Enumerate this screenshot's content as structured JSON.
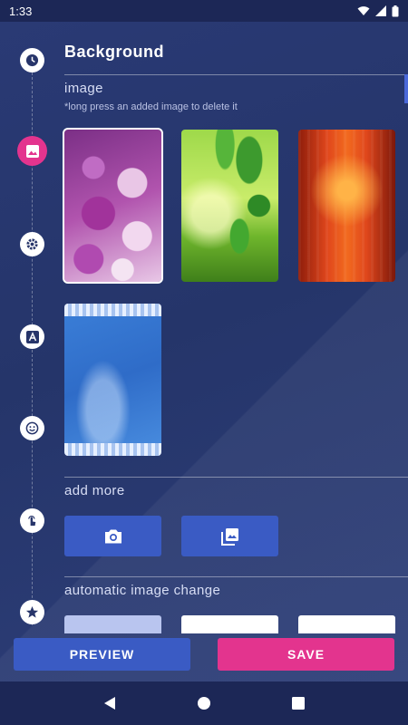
{
  "status_bar": {
    "time": "1:33"
  },
  "header": {
    "title": "Background"
  },
  "image_section": {
    "title": "image",
    "hint": "*long press an added image to delete it",
    "images": [
      {
        "name": "roses",
        "selected": true
      },
      {
        "name": "green leaves",
        "selected": false
      },
      {
        "name": "red pattern",
        "selected": false
      },
      {
        "name": "blue lace",
        "selected": false
      }
    ]
  },
  "add_more": {
    "title": "add more"
  },
  "auto_change": {
    "title": "automatic image change"
  },
  "actions": {
    "preview": "PREVIEW",
    "save": "SAVE"
  },
  "timeline_icons": [
    "clock-icon",
    "image-icon",
    "gear-icon",
    "text-icon",
    "emoji-icon",
    "touch-icon",
    "star-icon"
  ],
  "colors": {
    "accent_pink": "#e3348e",
    "button_blue": "#3a5bc4",
    "background": "#26366a"
  }
}
